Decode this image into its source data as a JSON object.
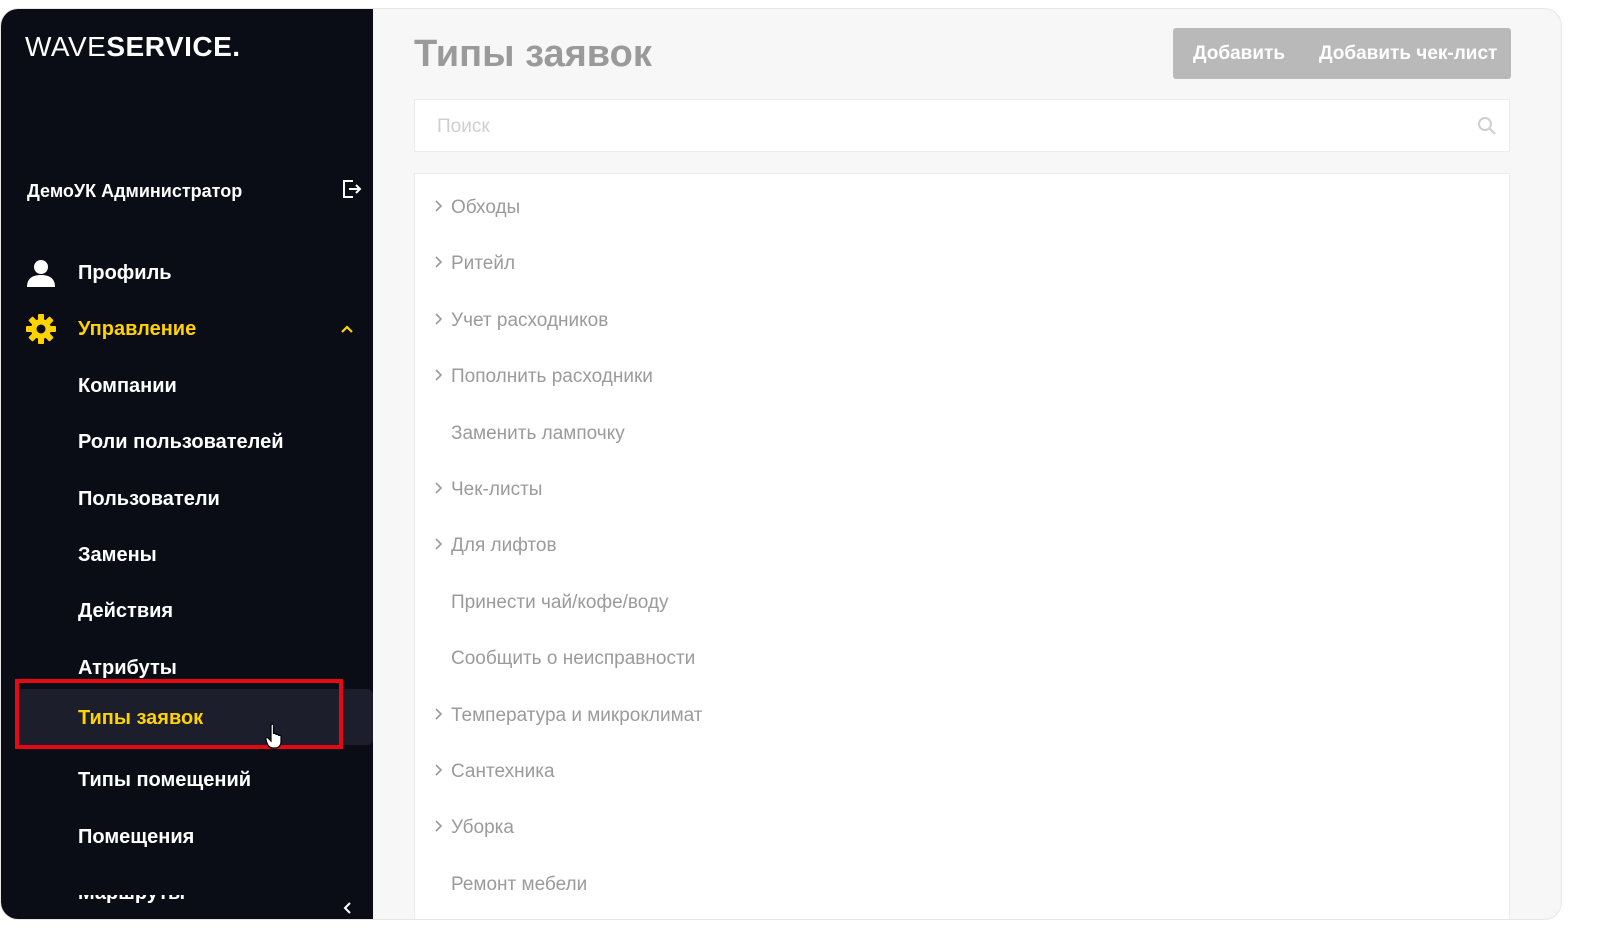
{
  "sidebar": {
    "logo": {
      "light": "WAVE",
      "bold": "SERVICE."
    },
    "user_name": "ДемоУК Администратор",
    "nav": [
      {
        "label": "Профиль"
      },
      {
        "label": "Управление"
      }
    ],
    "sub_items": [
      {
        "label": "Компании"
      },
      {
        "label": "Роли пользователей"
      },
      {
        "label": "Пользователи"
      },
      {
        "label": "Замены"
      },
      {
        "label": "Действия"
      },
      {
        "label": "Атрибуты"
      },
      {
        "label": "Типы заявок"
      },
      {
        "label": "Типы помещений"
      },
      {
        "label": "Помещения"
      },
      {
        "label": "Маршруты"
      }
    ]
  },
  "main": {
    "title": "Типы заявок",
    "buttons": {
      "add": "Добавить",
      "add_checklist": "Добавить чек-лист"
    },
    "search": {
      "placeholder": "Поиск",
      "value": ""
    },
    "items": [
      {
        "label": "Обходы",
        "expandable": true
      },
      {
        "label": "Ритейл",
        "expandable": true
      },
      {
        "label": "Учет расходников",
        "expandable": true
      },
      {
        "label": "Пополнить расходники",
        "expandable": true
      },
      {
        "label": "Заменить лампочку",
        "expandable": false
      },
      {
        "label": "Чек-листы",
        "expandable": true
      },
      {
        "label": "Для лифтов",
        "expandable": true
      },
      {
        "label": "Принести чай/кофе/воду",
        "expandable": false
      },
      {
        "label": "Сообщить о неисправности",
        "expandable": false
      },
      {
        "label": "Температура и микроклимат",
        "expandable": true
      },
      {
        "label": "Сантехника",
        "expandable": true
      },
      {
        "label": "Уборка",
        "expandable": true
      },
      {
        "label": "Ремонт мебели",
        "expandable": false
      }
    ]
  },
  "colors": {
    "sidebar_bg": "#0b0d16",
    "accent": "#ffd200",
    "highlight": "#e50914",
    "button_bg": "#b9b9b9"
  },
  "icons": {
    "logout": "logout-icon",
    "profile": "user-icon",
    "management": "gear-icon",
    "expand": "chevron-up-icon",
    "search": "search-icon",
    "collapse": "chevron-left-icon",
    "item_expand": "chevron-right-icon"
  }
}
